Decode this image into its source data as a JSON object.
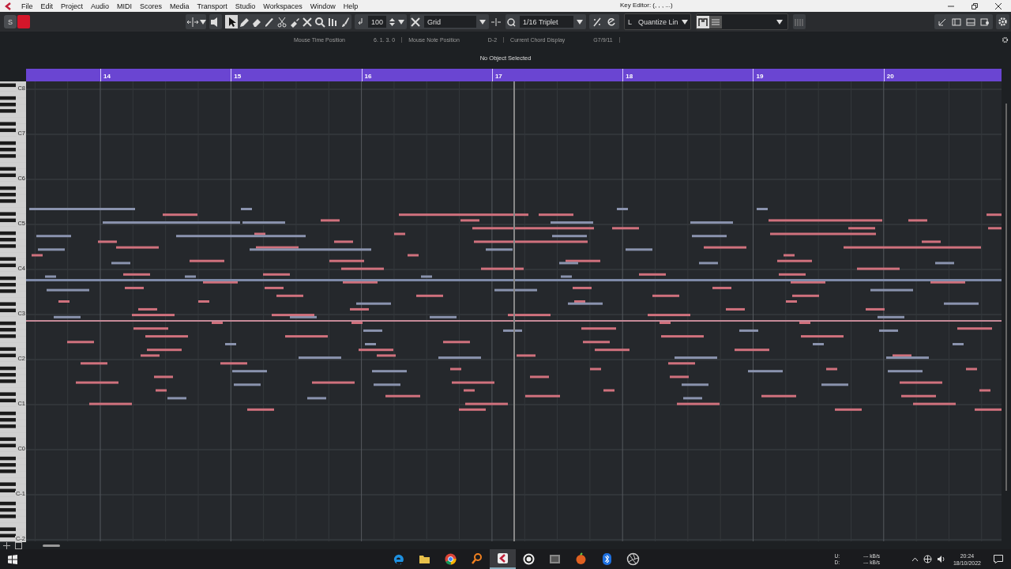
{
  "title_bar": {
    "menu": [
      "File",
      "Edit",
      "Project",
      "Audio",
      "MIDI",
      "Scores",
      "Media",
      "Transport",
      "Studio",
      "Workspaces",
      "Window",
      "Help"
    ],
    "title": "Key Editor: (, , , ...)"
  },
  "toolbar": {
    "solo": "S",
    "record_enabled": true,
    "tools": [
      {
        "kind": "arrow",
        "selected": true
      },
      {
        "kind": "pencil",
        "selected": false
      },
      {
        "kind": "eraser",
        "selected": false
      },
      {
        "kind": "knife",
        "selected": false
      },
      {
        "kind": "scissors",
        "selected": false
      },
      {
        "kind": "glue",
        "selected": false
      },
      {
        "kind": "mute",
        "selected": false
      },
      {
        "kind": "zoom",
        "selected": false
      },
      {
        "kind": "line",
        "selected": false
      },
      {
        "kind": "brush",
        "selected": false
      }
    ],
    "velocity": "100",
    "snap": "Grid",
    "quantize": "1/16  Triplet",
    "length": "L",
    "length_quantize": "Quantize Lin"
  },
  "info_line": [
    {
      "label": "Mouse Time Position",
      "value": "6. 1. 3.   0"
    },
    {
      "label": "Mouse Note Position",
      "value": "D-2"
    },
    {
      "label": "Current Chord Display",
      "value": "G7/9/11"
    }
  ],
  "status": "No Object Selected",
  "ruler": {
    "bars": [
      "14",
      "15",
      "16",
      "17",
      "18",
      "19",
      "20"
    ]
  },
  "keyboard": {
    "octaves": [
      "C8",
      "C7",
      "C6",
      "C5",
      "C4",
      "C3",
      "C2",
      "C1",
      "C0",
      "C-1",
      "C-2"
    ]
  },
  "taskbar": {
    "apps": [
      {
        "kind": "edge",
        "active": false
      },
      {
        "kind": "folder",
        "active": false
      },
      {
        "kind": "chrome",
        "active": false
      },
      {
        "kind": "search",
        "active": false
      },
      {
        "kind": "cubase",
        "active": true
      },
      {
        "kind": "circle",
        "active": false
      },
      {
        "kind": "window",
        "active": false
      },
      {
        "kind": "fruit",
        "active": false
      },
      {
        "kind": "bluetooth",
        "active": false
      },
      {
        "kind": "aperture",
        "active": false
      }
    ],
    "network": [
      {
        "label": "U:",
        "rate": "--- kB/s"
      },
      {
        "label": "D:",
        "rate": "--- kB/s"
      }
    ],
    "time": "20:24",
    "date": "18/10/2022"
  }
}
